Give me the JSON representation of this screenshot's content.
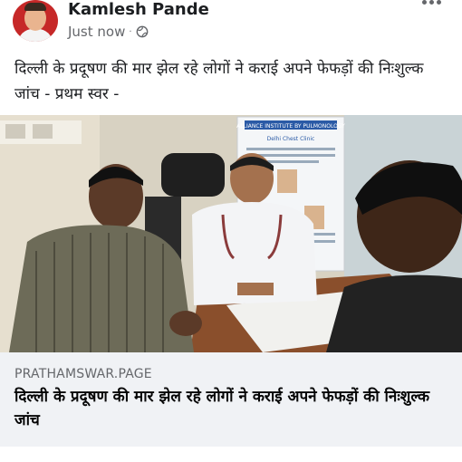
{
  "post": {
    "author": "Kamlesh Pande",
    "timestamp": "Just now",
    "separator": "·",
    "privacy_icon": "globe-icon",
    "text": "दिल्ली के प्रदूषण की मार झेल रहे लोगों ने कराई अपने फेफड़ों की निःशुल्क जांच - प्रथम स्वर -"
  },
  "photo": {
    "poster_heading": "ALLIANCE INSTITUTE BY PULMONOLOGY",
    "poster_body": "Delhi Chest Clinic"
  },
  "link_preview": {
    "domain": "PRATHAMSWAR.PAGE",
    "title": "दिल्ली के प्रदूषण की मार झेल रहे लोगों ने कराई अपने फेफड़ों की निःशुल्क जांच"
  },
  "colors": {
    "text_primary": "#1c1e21",
    "text_secondary": "#65676b",
    "preview_bg": "#f0f2f5",
    "avatar_bg": "#c62828"
  }
}
